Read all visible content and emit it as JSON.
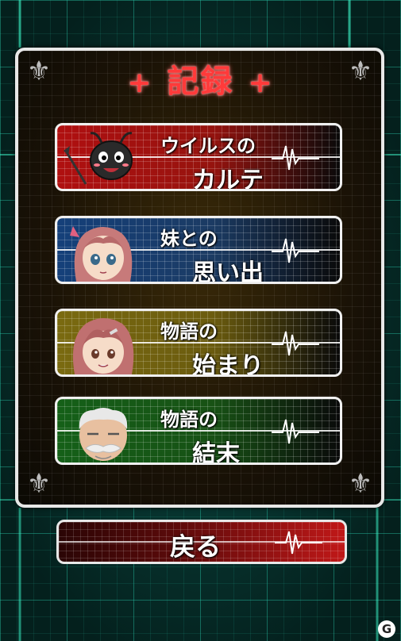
{
  "screen": {
    "title": "記録",
    "title_deco_left": "+",
    "title_deco_right": "+",
    "corner_glyph": "⚜"
  },
  "menu": [
    {
      "line1": "ウイルスの",
      "line2": "カルテ",
      "color": "#b01010",
      "portrait_icon": "devil-virus-portrait"
    },
    {
      "line1": "妹との",
      "line2": "思い出",
      "color": "#15407a",
      "portrait_icon": "sister-portrait"
    },
    {
      "line1": "物語の",
      "line2": "始まり",
      "color": "#7a6a10",
      "portrait_icon": "girl-portrait"
    },
    {
      "line1": "物語の",
      "line2": "結末",
      "color": "#156018",
      "portrait_icon": "old-man-portrait"
    }
  ],
  "back_button": {
    "label": "戻る"
  },
  "watermark": {
    "text": "G"
  }
}
